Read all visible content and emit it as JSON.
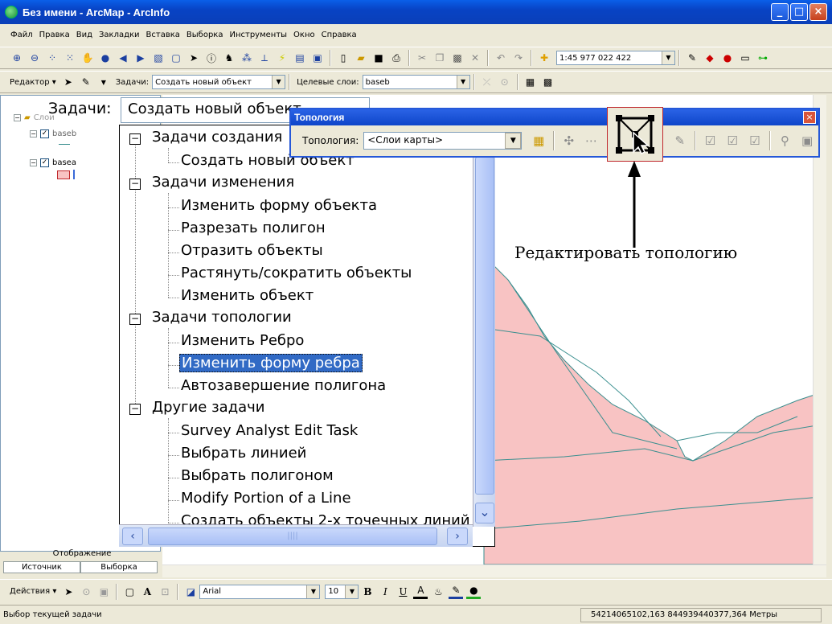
{
  "window": {
    "title": "Без имени - ArcMap - ArcInfo"
  },
  "menu": [
    "Файл",
    "Правка",
    "Вид",
    "Закладки",
    "Вставка",
    "Выборка",
    "Инструменты",
    "Окно",
    "Справка"
  ],
  "toolbar": {
    "scale": "1:45 977 022 422"
  },
  "editor": {
    "editor_label": "Редактор ▾",
    "task_label": "Задачи:",
    "task_value": "Создать новый объект",
    "target_label": "Целевые слои:",
    "target_value": "baseb"
  },
  "toc": {
    "root": "Слои",
    "layers": [
      {
        "name": "baseb"
      },
      {
        "name": "basea"
      }
    ],
    "tabs": [
      "Отображение",
      "Источник",
      "Выборка"
    ]
  },
  "tasks_zoom": {
    "label": "Задачи:",
    "value": "Создать новый объект",
    "groups": [
      {
        "name": "Задачи создания",
        "items": [
          "Создать новый объект"
        ]
      },
      {
        "name": "Задачи изменения",
        "items": [
          "Изменить форму объекта",
          "Разрезать полигон",
          "Отразить объекты",
          "Растянуть/сократить объекты",
          "Изменить объект"
        ]
      },
      {
        "name": "Задачи топологии",
        "items": [
          "Изменить Ребро",
          "Изменить форму ребра",
          "Автозавершение полигона"
        ]
      },
      {
        "name": "Другие задачи",
        "items": [
          "Survey Analyst Edit Task",
          "Выбрать линией",
          "Выбрать полигоном",
          "Modify Portion of a Line",
          "Создать объекты 2-х точечных линий"
        ]
      }
    ],
    "selected": "Изменить форму ребра"
  },
  "topology": {
    "title": "Топология",
    "label": "Топология:",
    "value": "<Слои карты>"
  },
  "annotation": "Редактировать топологию",
  "drawing": {
    "actions": "Действия ▾",
    "font": "Arial",
    "size": "10"
  },
  "status": {
    "message": "Выбор текущей задачи",
    "coords": "54214065102,163  844939440377,364 Метры"
  },
  "colors": {
    "polygon_fill": "#f8c3c3",
    "polygon_edge": "#3a8f8f",
    "selection": "#316ac5"
  }
}
